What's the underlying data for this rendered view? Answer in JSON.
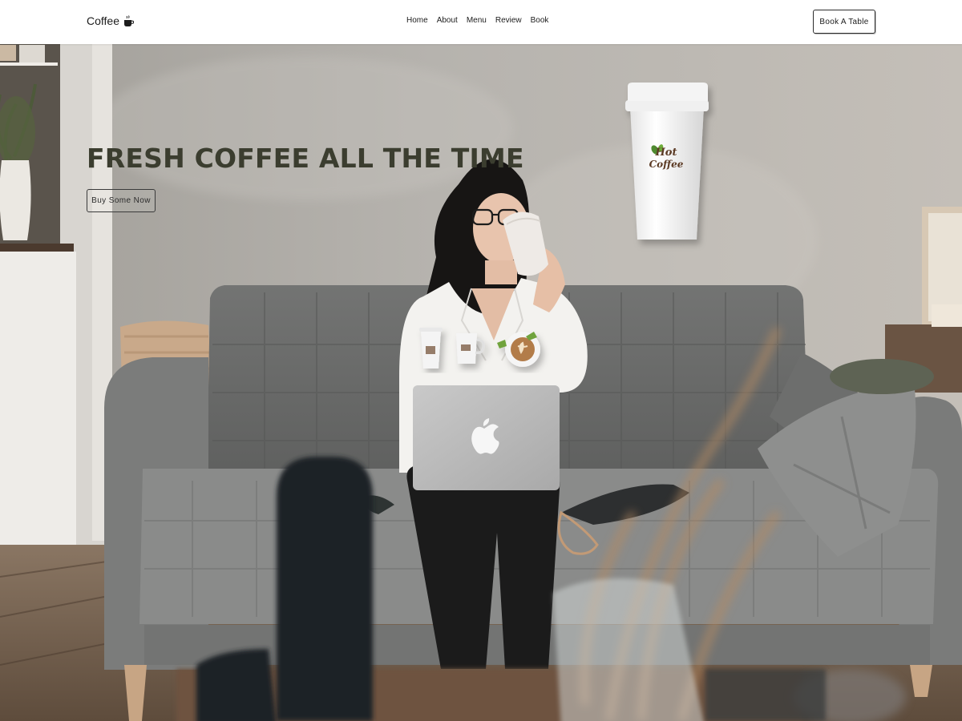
{
  "brand": {
    "name": "Coffee",
    "icon": "coffee-cup-icon"
  },
  "nav": {
    "items": [
      "Home",
      "About",
      "Menu",
      "Review",
      "Book"
    ]
  },
  "header": {
    "cta_label": "Book A Table"
  },
  "hero": {
    "title": "FRESH COFFEE ALL THE TIME",
    "button_label": "Buy Some Now",
    "cup_logo_line1": "Hot",
    "cup_logo_line2": "Coffee"
  },
  "colors": {
    "title": "#3b3d2f",
    "text": "#1c1c1c",
    "header_bg": "#ffffff",
    "logo_brown": "#5b3a24",
    "logo_green": "#4f8a2f"
  }
}
